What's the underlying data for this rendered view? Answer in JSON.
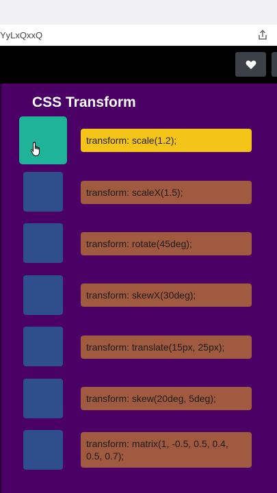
{
  "browser": {
    "url_fragment": "YyLxQxxQ"
  },
  "page": {
    "title": "CSS Transform"
  },
  "colors": {
    "background": "#4b0066",
    "box_default": "#2e4e8c",
    "box_active": "#1fb39a",
    "label_default": "#a05a3f",
    "label_active": "#f4c418"
  },
  "icons": {
    "share": "share-icon",
    "heart": "heart-icon",
    "cursor": "hand-cursor-icon"
  },
  "items": [
    {
      "label": "transform: scale(1.2);",
      "active": true
    },
    {
      "label": "transform: scaleX(1.5);",
      "active": false
    },
    {
      "label": "transform: rotate(45deg);",
      "active": false
    },
    {
      "label": "transform: skewX(30deg);",
      "active": false
    },
    {
      "label": "transform: translate(15px, 25px);",
      "active": false
    },
    {
      "label": "transform: skew(20deg, 5deg);",
      "active": false
    },
    {
      "label": "transform: matrix(1, -0.5, 0.5, 0.4, 0.5, 0.7);",
      "active": false
    }
  ]
}
